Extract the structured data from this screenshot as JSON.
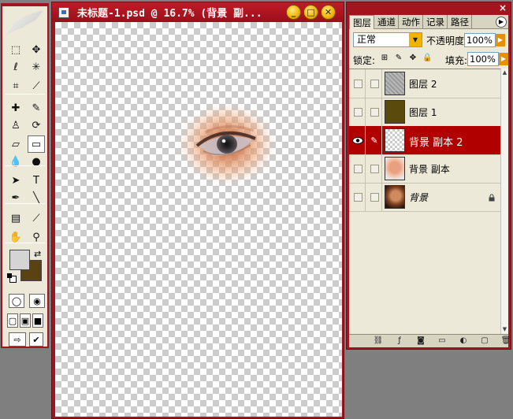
{
  "document": {
    "title": "未标题-1.psd @ 16.7% (背景 副...",
    "buttons": {
      "minimize": "_",
      "maximize": "□",
      "close": "✕"
    }
  },
  "toolbox": {
    "tools": [
      {
        "icon": "marquee-icon",
        "glyph": "⬚"
      },
      {
        "icon": "move-icon",
        "glyph": "✥"
      },
      {
        "icon": "lasso-icon",
        "glyph": "ℓ"
      },
      {
        "icon": "magic-wand-icon",
        "glyph": "✳"
      },
      {
        "icon": "crop-icon",
        "glyph": "⌗"
      },
      {
        "icon": "slice-icon",
        "glyph": "⟋"
      },
      {
        "icon": "healing-brush-icon",
        "glyph": "✚"
      },
      {
        "icon": "brush-icon",
        "glyph": "✎"
      },
      {
        "icon": "clone-stamp-icon",
        "glyph": "♙"
      },
      {
        "icon": "history-brush-icon",
        "glyph": "⟳"
      },
      {
        "icon": "eraser-icon",
        "glyph": "▱"
      },
      {
        "icon": "gradient-icon",
        "glyph": "▭"
      },
      {
        "icon": "blur-icon",
        "glyph": "💧"
      },
      {
        "icon": "dodge-icon",
        "glyph": "●"
      },
      {
        "icon": "path-select-icon",
        "glyph": "➤"
      },
      {
        "icon": "type-icon",
        "glyph": "T"
      },
      {
        "icon": "pen-icon",
        "glyph": "✒"
      },
      {
        "icon": "line-icon",
        "glyph": "╲"
      },
      {
        "icon": "notes-icon",
        "glyph": "▤"
      },
      {
        "icon": "eyedropper-icon",
        "glyph": "⟋"
      },
      {
        "icon": "hand-icon",
        "glyph": "✋"
      },
      {
        "icon": "zoom-icon",
        "glyph": "⚲"
      }
    ],
    "foreground_color": "#d4d4d4",
    "background_color": "#5a4212"
  },
  "layers_panel": {
    "tabs": [
      "图层",
      "通道",
      "动作",
      "记录",
      "路径"
    ],
    "close": "×",
    "blend_mode": "正常",
    "opacity_label": "不透明度:",
    "opacity_value": "100%",
    "lock_label": "锁定:",
    "fill_label": "填充:",
    "fill_value": "100%",
    "layers": [
      {
        "name": "图层 2",
        "thumb": "noise",
        "visible": false,
        "selected": false,
        "locked": false
      },
      {
        "name": "图层 1",
        "thumb": "olive",
        "visible": false,
        "selected": false,
        "locked": false
      },
      {
        "name": "背景 副本 2",
        "thumb": "checker",
        "visible": true,
        "selected": true,
        "locked": false
      },
      {
        "name": "背景 副本",
        "thumb": "face-faded",
        "visible": false,
        "selected": false,
        "locked": false
      },
      {
        "name": "背景",
        "thumb": "face",
        "visible": false,
        "selected": false,
        "locked": true
      }
    ],
    "bottom_icons": [
      "link-icon",
      "layer-style-icon",
      "mask-icon",
      "folder-icon",
      "adjustment-icon",
      "new-layer-icon",
      "trash-icon"
    ]
  },
  "colors": {
    "accent": "#a3141f",
    "selection": "#b00000",
    "workspace": "#7f7f7f"
  }
}
